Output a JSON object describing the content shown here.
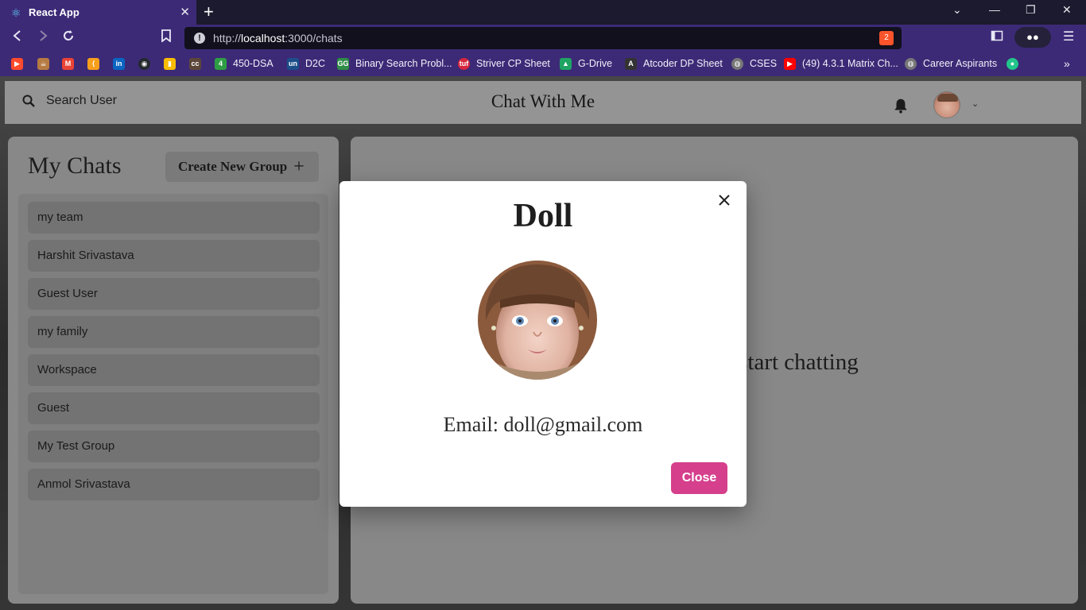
{
  "browser": {
    "tab_title": "React App",
    "url_scheme": "http://",
    "url_host": "localhost",
    "url_path": ":3000/chats",
    "brave_badge": "2"
  },
  "bookmarks": [
    {
      "label": "",
      "icon": "youtube-red-icon",
      "color": "#ff4b2b"
    },
    {
      "label": "",
      "icon": "codechef-icon",
      "color": "#b57b42"
    },
    {
      "label": "",
      "icon": "gmail-icon",
      "color": "#ea4335"
    },
    {
      "label": "",
      "icon": "leetcode-icon",
      "color": "#f89f1b"
    },
    {
      "label": "",
      "icon": "linkedin-icon",
      "color": "#0a66c2"
    },
    {
      "label": "",
      "icon": "github-icon",
      "color": "#24292e"
    },
    {
      "label": "",
      "icon": "chart-icon",
      "color": "#fbbc04"
    },
    {
      "label": "",
      "icon": "cc-icon",
      "color": "#5b4638"
    },
    {
      "label": "450-DSA",
      "icon": "four-icon",
      "color": "#2e9e44"
    },
    {
      "label": "D2C",
      "icon": "unstop-icon",
      "color": "#1c4e8a"
    },
    {
      "label": "Binary Search Probl...",
      "icon": "gfg-icon",
      "color": "#2f8d46"
    },
    {
      "label": "Striver CP Sheet",
      "icon": "tuf-icon",
      "color": "#d7263d"
    },
    {
      "label": "G-Drive",
      "icon": "google-drive-icon",
      "color": "#1fa463"
    },
    {
      "label": "Atcoder DP Sheet",
      "icon": "atcoder-icon",
      "color": "#333333"
    },
    {
      "label": "CSES",
      "icon": "globe-icon",
      "color": "#777777"
    },
    {
      "label": "(49) 4.3.1 Matrix Ch...",
      "icon": "youtube-icon",
      "color": "#ff0000"
    },
    {
      "label": "Career Aspirants",
      "icon": "globe-icon",
      "color": "#777777"
    },
    {
      "label": "",
      "icon": "chat-bubble-icon",
      "color": "#22c58b"
    }
  ],
  "app": {
    "search_label": "Search User",
    "brand": "Chat With Me",
    "my_chats_title": "My Chats",
    "create_group_label": "Create New Group",
    "chats": [
      "my team",
      "Harshit Srivastava",
      "Guest User",
      "my family",
      "Workspace",
      "Guest",
      "My Test Group",
      "Anmol Srivastava"
    ],
    "chatbox_message": "Click on a user to start chatting"
  },
  "modal": {
    "name": "Doll",
    "email": "Email: doll@gmail.com",
    "close_label": "Close"
  },
  "colors": {
    "accent_pink": "#d53f8c",
    "browser_purple": "#3d2a77"
  }
}
